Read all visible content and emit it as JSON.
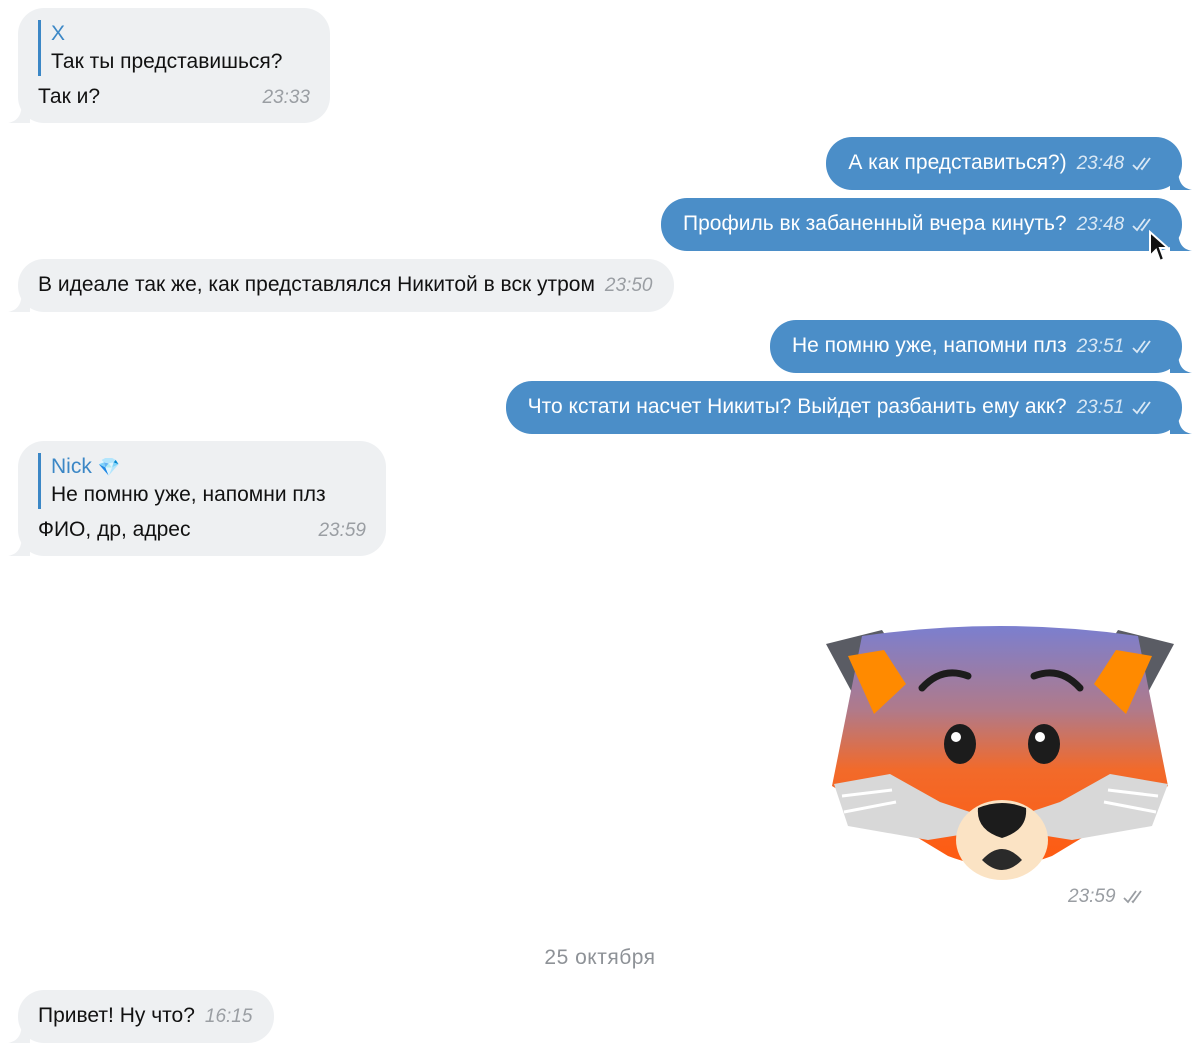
{
  "messages": [
    {
      "id": "m1",
      "direction": "in",
      "reply_name": "X",
      "reply_text": "Так ты представишься?",
      "text": "Так и?",
      "time": "23:33"
    },
    {
      "id": "m2",
      "direction": "out",
      "text": "А как представиться?)",
      "time": "23:48"
    },
    {
      "id": "m3",
      "direction": "out",
      "text": "Профиль вк забаненный вчера кинуть?",
      "time": "23:48"
    },
    {
      "id": "m4",
      "direction": "in",
      "text": "В идеале так же, как представлялся Никитой в вск утром",
      "time": "23:50"
    },
    {
      "id": "m5",
      "direction": "out",
      "text": "Не помню уже, напомни плз",
      "time": "23:51"
    },
    {
      "id": "m6",
      "direction": "out",
      "text": "Что кстати насчет Никиты? Выйдет разбанить ему акк?",
      "time": "23:51"
    },
    {
      "id": "m7",
      "direction": "in",
      "reply_name": "Nick",
      "reply_badge": "💎",
      "reply_text": "Не помню уже, напомни плз",
      "text": "ФИО, др, адрес",
      "time": "23:59"
    },
    {
      "id": "m8",
      "direction": "out",
      "sticker": "fox-face-sticker",
      "time": "23:59"
    },
    {
      "id": "m9",
      "direction": "in",
      "text": "Привет! Ну что?",
      "time": "16:15"
    }
  ],
  "date_separator": "25 октября",
  "colors": {
    "incoming_bubble": "#eef0f2",
    "outgoing_bubble": "#4b8ec8",
    "reply_accent": "#3b87c6"
  },
  "icons": {
    "read_status": "double-check-icon",
    "pointer": "mouse-cursor-icon"
  }
}
